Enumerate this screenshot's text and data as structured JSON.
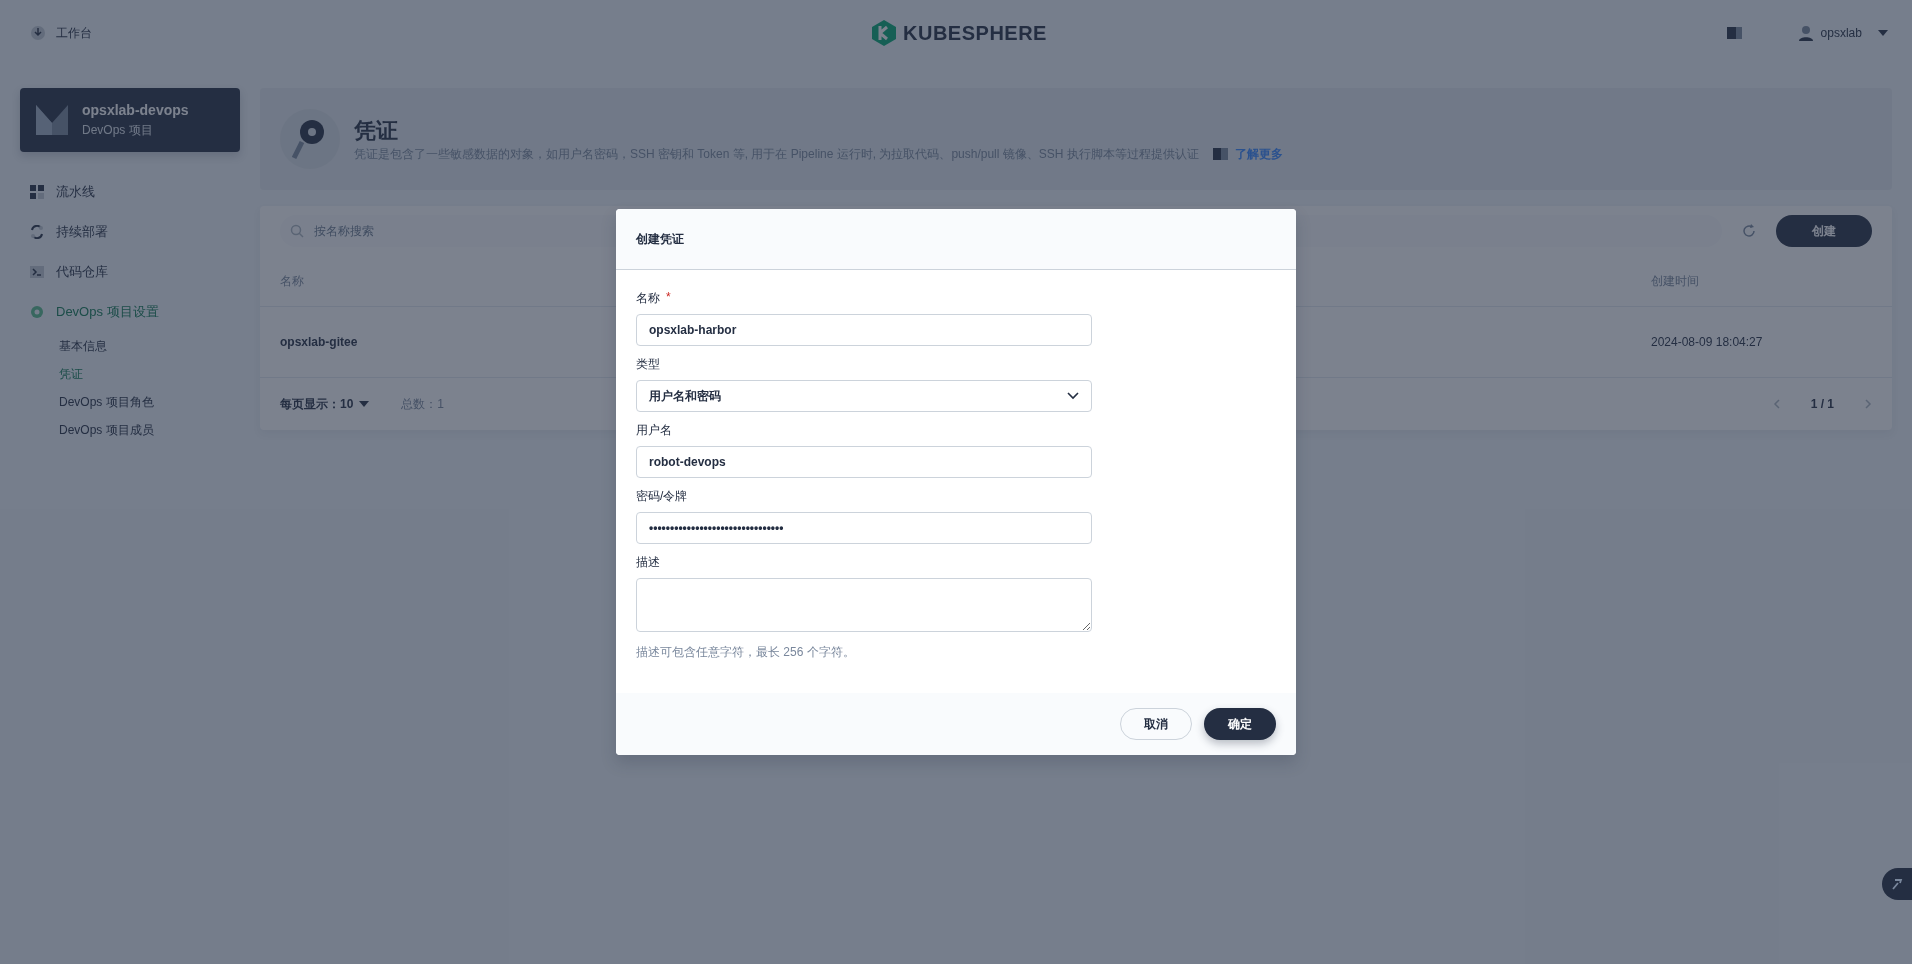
{
  "top_bar": {
    "workbench": "工作台",
    "logo": "KUBESPHERE",
    "user": "opsxlab"
  },
  "project": {
    "name": "opsxlab-devops",
    "type": "DevOps 项目"
  },
  "sidebar": {
    "items": [
      {
        "kind": "pipeline",
        "label": "流水线",
        "selected": false
      },
      {
        "kind": "deploy",
        "label": "持续部署",
        "selected": false
      },
      {
        "kind": "repo",
        "label": "代码仓库",
        "selected": false
      },
      {
        "kind": "settings",
        "label": "DevOps 项目设置",
        "selected": true,
        "children": [
          {
            "label": "基本信息",
            "selected": false
          },
          {
            "label": "凭证",
            "selected": true
          },
          {
            "label": "DevOps 项目角色",
            "selected": false
          },
          {
            "label": "DevOps 项目成员",
            "selected": false
          }
        ]
      }
    ]
  },
  "banner": {
    "title": "凭证",
    "description": "凭证是包含了一些敏感数据的对象，如用户名密码，SSH 密钥和 Token 等, 用于在 Pipeline 运行时, 为拉取代码、push/pull 镜像、SSH 执行脚本等过程提供认证",
    "link": "了解更多"
  },
  "toolbar": {
    "search_placeholder": "按名称搜索",
    "create_button": "创建"
  },
  "table": {
    "columns": [
      "名称",
      "创建时间"
    ],
    "rows": [
      {
        "name": "opsxlab-gitee",
        "created": "2024-08-09 18:04:27"
      }
    ]
  },
  "pagination": {
    "per_page_label": "每页显示：",
    "per_page": "10",
    "total": "总数：1",
    "page": "1 / 1"
  },
  "dialog": {
    "title": "创建凭证",
    "required_mark": "*",
    "fields": [
      {
        "kind": "text",
        "label": "名称",
        "required": true,
        "value": "opsxlab-harbor"
      },
      {
        "kind": "select",
        "label": "类型",
        "required": false,
        "value": "用户名和密码"
      },
      {
        "kind": "text",
        "label": "用户名",
        "required": false,
        "value": "robot-devops"
      },
      {
        "kind": "text",
        "label": "密码/令牌",
        "required": false,
        "value": "••••••••••••••••••••••••••••••••"
      },
      {
        "kind": "textarea",
        "label": "描述",
        "required": false,
        "hint": "描述可包含任意字符，最长 256 个字符。"
      }
    ],
    "buttons": [
      {
        "kind": "secondary",
        "label": "取消"
      },
      {
        "kind": "primary",
        "label": "确定"
      }
    ]
  }
}
